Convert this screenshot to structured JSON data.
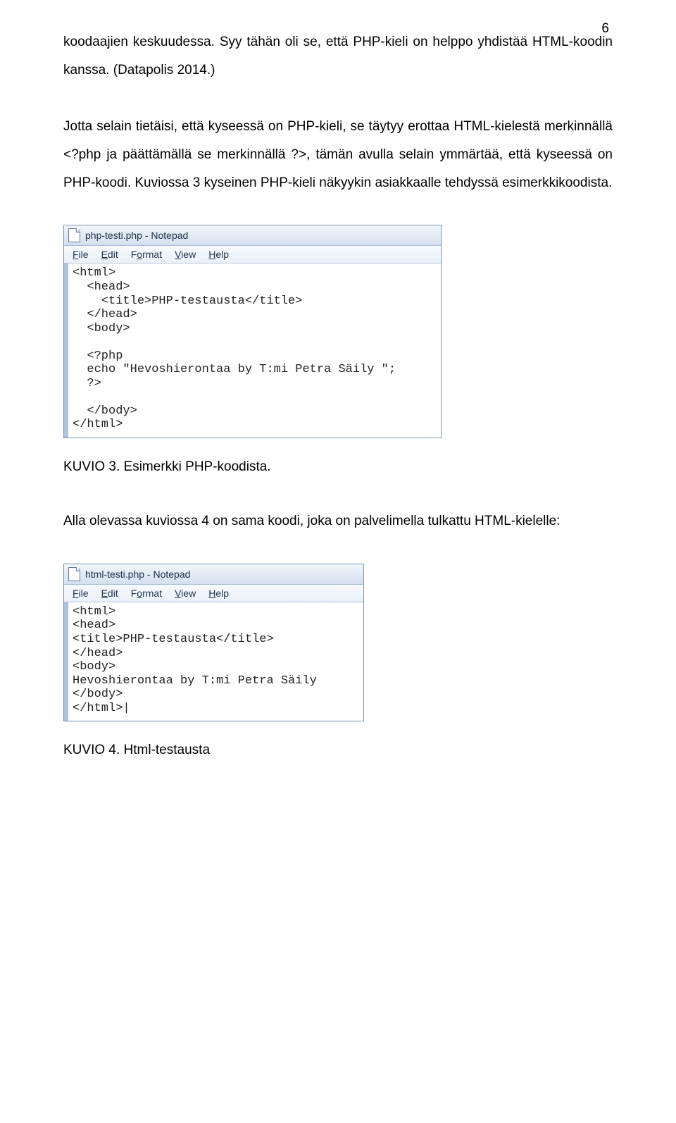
{
  "pageNumber": "6",
  "para1": "koodaajien keskuudessa. Syy tähän oli se, että PHP-kieli on helppo yhdistää HTML-koodin kanssa. (Datapolis 2014.)",
  "para2": "Jotta selain tietäisi, että kyseessä on PHP-kieli, se täytyy erottaa HTML-kielestä merkinnällä <?php ja päättämällä se merkinnällä ?>, tämän avulla selain ymmärtää, että kyseessä on PHP-koodi. Kuviossa 3 kyseinen PHP-kieli näkyykin asiakkaalle tehdyssä esimerkkikoodista.",
  "caption1": "KUVIO 3. Esimerkki PHP-koodista.",
  "para3": "Alla olevassa kuviossa 4 on sama koodi, joka on palvelimella tulkattu HTML-kielelle:",
  "caption2": "KUVIO 4. Html-testausta",
  "notepad1": {
    "title": "php-testi.php - Notepad",
    "menu": {
      "file": "File",
      "edit": "Edit",
      "format": "Format",
      "view": "View",
      "help": "Help"
    },
    "code": "<html>\n  <head>\n    <title>PHP-testausta</title>\n  </head>\n  <body>\n\n  <?php\n  echo \"Hevoshierontaa by T:mi Petra Säily \";\n  ?>\n\n  </body>\n</html>"
  },
  "notepad2": {
    "title": "html-testi.php - Notepad",
    "menu": {
      "file": "File",
      "edit": "Edit",
      "format": "Format",
      "view": "View",
      "help": "Help"
    },
    "code": "<html>\n<head>\n<title>PHP-testausta</title>\n</head>\n<body>\nHevoshierontaa by T:mi Petra Säily\n</body>\n</html>|"
  }
}
